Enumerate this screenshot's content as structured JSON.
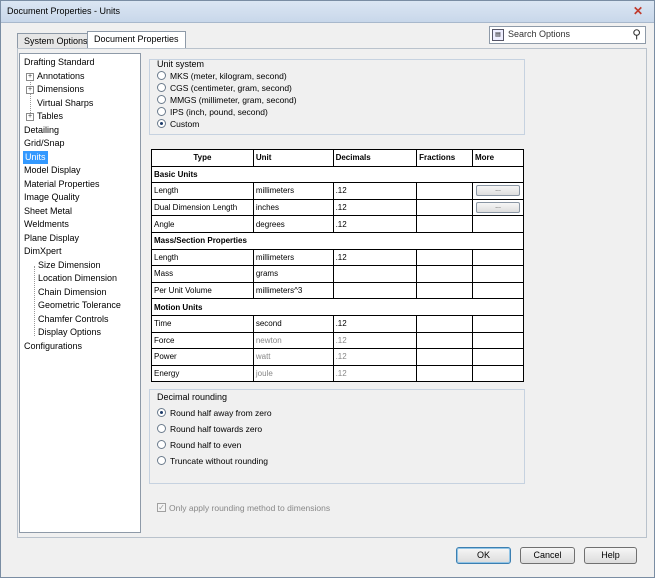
{
  "window": {
    "title": "Document Properties - Units",
    "close": "✕"
  },
  "tabs": [
    {
      "label": "System Options"
    },
    {
      "label": "Document Properties"
    }
  ],
  "search": {
    "placeholder": "Search Options"
  },
  "tree": {
    "items": [
      {
        "label": "Drafting Standard"
      },
      {
        "label": "Annotations"
      },
      {
        "label": "Dimensions"
      },
      {
        "label": "Virtual Sharps"
      },
      {
        "label": "Tables"
      },
      {
        "label": "Detailing"
      },
      {
        "label": "Grid/Snap"
      },
      {
        "label": "Units"
      },
      {
        "label": "Model Display"
      },
      {
        "label": "Material Properties"
      },
      {
        "label": "Image Quality"
      },
      {
        "label": "Sheet Metal"
      },
      {
        "label": "Weldments"
      },
      {
        "label": "Plane Display"
      },
      {
        "label": "DimXpert"
      },
      {
        "label": "Size Dimension"
      },
      {
        "label": "Location Dimension"
      },
      {
        "label": "Chain Dimension"
      },
      {
        "label": "Geometric Tolerance"
      },
      {
        "label": "Chamfer Controls"
      },
      {
        "label": "Display Options"
      },
      {
        "label": "Configurations"
      }
    ]
  },
  "unit_system": {
    "label": "Unit system",
    "options": [
      {
        "label": "MKS  (meter, kilogram, second)"
      },
      {
        "label": "CGS  (centimeter, gram, second)"
      },
      {
        "label": "MMGS (millimeter, gram, second)"
      },
      {
        "label": "IPS  (inch, pound, second)"
      },
      {
        "label": "Custom"
      }
    ],
    "selected": "Custom"
  },
  "table": {
    "headers": {
      "type": "Type",
      "unit": "Unit",
      "decimals": "Decimals",
      "fractions": "Fractions",
      "more": "More"
    },
    "sections": {
      "basic": "Basic Units",
      "mass": "Mass/Section Properties",
      "motion": "Motion Units"
    },
    "rows": {
      "length": {
        "type": "Length",
        "unit": "millimeters",
        "decimals": ".12"
      },
      "dual": {
        "type": "Dual Dimension Length",
        "unit": "inches",
        "decimals": ".12"
      },
      "angle": {
        "type": "Angle",
        "unit": "degrees",
        "decimals": ".12"
      },
      "mlength": {
        "type": "Length",
        "unit": "millimeters",
        "decimals": ".12"
      },
      "mass": {
        "type": "Mass",
        "unit": "grams",
        "decimals": ""
      },
      "volume": {
        "type": "Per Unit Volume",
        "unit": "millimeters^3",
        "decimals": ""
      },
      "time": {
        "type": "Time",
        "unit": "second",
        "decimals": ".12"
      },
      "force": {
        "type": "Force",
        "unit": "newton",
        "decimals": ".12"
      },
      "power": {
        "type": "Power",
        "unit": "watt",
        "decimals": ".12"
      },
      "energy": {
        "type": "Energy",
        "unit": "joule",
        "decimals": ".12"
      }
    },
    "more_label": "..."
  },
  "rounding": {
    "label": "Decimal rounding",
    "options": [
      {
        "label": "Round half away from zero"
      },
      {
        "label": "Round half towards zero"
      },
      {
        "label": "Round half to even"
      },
      {
        "label": "Truncate without rounding"
      }
    ],
    "selected": "Round half away from zero"
  },
  "only_apply": {
    "label": "Only apply rounding method to dimensions",
    "checked": true,
    "mark": "✓"
  },
  "buttons": {
    "ok": "OK",
    "cancel": "Cancel",
    "help": "Help"
  }
}
